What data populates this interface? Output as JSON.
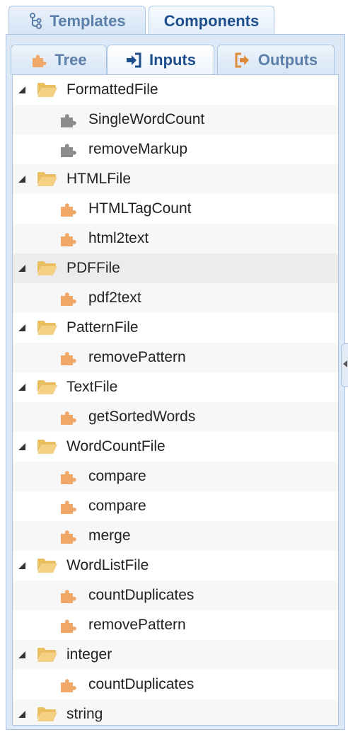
{
  "top_tabs": [
    {
      "label": "Templates",
      "icon": "tree-branch-icon",
      "active": false
    },
    {
      "label": "Components",
      "active": true
    }
  ],
  "sub_tabs": [
    {
      "label": "Tree",
      "icon": "puzzle-icon",
      "active": false
    },
    {
      "label": "Inputs",
      "icon": "sign-in-icon",
      "active": true
    },
    {
      "label": "Outputs",
      "icon": "sign-out-icon",
      "active": false
    }
  ],
  "colors": {
    "accent": "#1f4e8c",
    "inactive_tab": "#5b7fa8",
    "border": "#a9c4e3",
    "folder": "#f0c870",
    "component": "#f0a868",
    "component_gray": "#8c8c8c"
  },
  "tree": [
    {
      "type": "folder",
      "label": "FormattedFile"
    },
    {
      "type": "component",
      "label": "SingleWordCount",
      "gray": true
    },
    {
      "type": "component",
      "label": "removeMarkup",
      "gray": true
    },
    {
      "type": "folder",
      "label": "HTMLFile"
    },
    {
      "type": "component",
      "label": "HTMLTagCount"
    },
    {
      "type": "component",
      "label": "html2text"
    },
    {
      "type": "folder",
      "label": "PDFFile",
      "selected": true
    },
    {
      "type": "component",
      "label": "pdf2text"
    },
    {
      "type": "folder",
      "label": "PatternFile"
    },
    {
      "type": "component",
      "label": "removePattern"
    },
    {
      "type": "folder",
      "label": "TextFile"
    },
    {
      "type": "component",
      "label": "getSortedWords"
    },
    {
      "type": "folder",
      "label": "WordCountFile"
    },
    {
      "type": "component",
      "label": "compare"
    },
    {
      "type": "component",
      "label": "compare"
    },
    {
      "type": "component",
      "label": "merge"
    },
    {
      "type": "folder",
      "label": "WordListFile"
    },
    {
      "type": "component",
      "label": "countDuplicates"
    },
    {
      "type": "component",
      "label": "removePattern"
    },
    {
      "type": "folder",
      "label": "integer"
    },
    {
      "type": "component",
      "label": "countDuplicates"
    },
    {
      "type": "folder",
      "label": "string"
    }
  ]
}
